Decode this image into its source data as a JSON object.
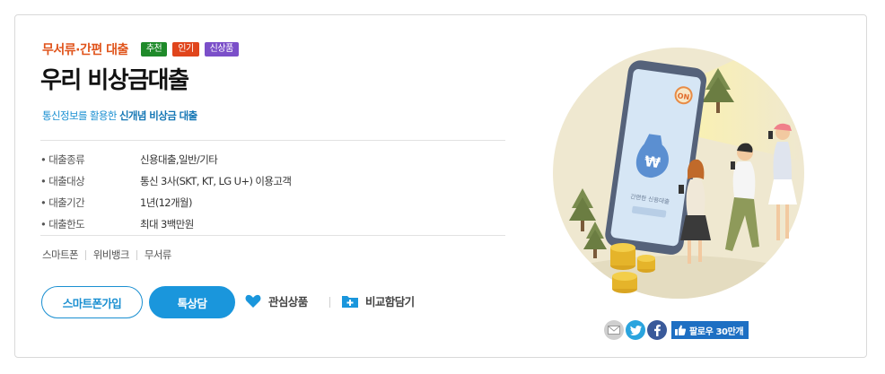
{
  "product": {
    "category": "무서류·간편 대출",
    "badges": [
      {
        "label": "추천",
        "color": "#1f8a2a"
      },
      {
        "label": "인기",
        "color": "#e0451c"
      },
      {
        "label": "신상품",
        "color": "#7b4fc9"
      }
    ],
    "title": "우리 비상금대출",
    "subtitle_prefix": "통신정보를 활용한 ",
    "subtitle_emphasis": "신개념 비상금 대출"
  },
  "specs": [
    {
      "label": "대출종류",
      "value": "신용대출,일반/기타"
    },
    {
      "label": "대출대상",
      "value": "통신 3사(SKT, KT, LG U+) 이용고객"
    },
    {
      "label": "대출기간",
      "value": "1년(12개월)"
    },
    {
      "label": "대출한도",
      "value": "최대 3백만원"
    }
  ],
  "tags": [
    "스마트폰",
    "위비뱅크",
    "무서류"
  ],
  "buttons": {
    "join": "스마트폰가입",
    "consult": "톡상담",
    "favorite": "관심상품",
    "compare": "비교함담기"
  },
  "share": {
    "follow_label": "팔로우 30만개"
  },
  "illustration": {
    "phone_on_label": "ON",
    "won_symbol": "₩",
    "phone_caption": "간편한 신용대출"
  },
  "colors": {
    "accent_blue": "#1a96dc",
    "accent_orange": "#e0541b",
    "twitter": "#2aa4de",
    "facebook": "#3a5a9a",
    "mail": "#b9b9b9"
  }
}
